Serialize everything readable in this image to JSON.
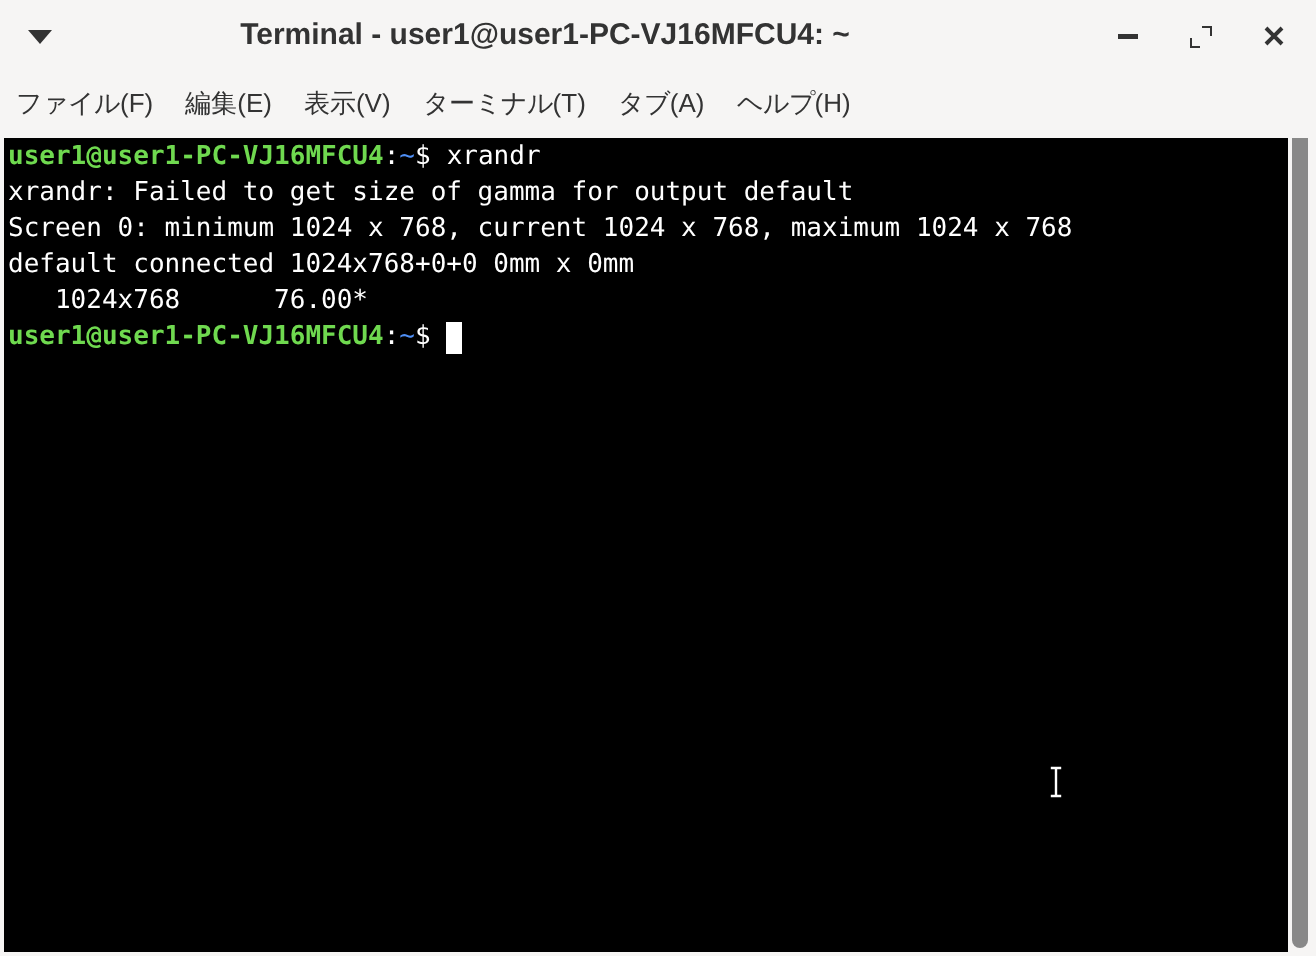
{
  "window": {
    "title": "Terminal - user1@user1-PC-VJ16MFCU4: ~"
  },
  "menu": [
    "ファイル(F)",
    "編集(E)",
    "表示(V)",
    "ターミナル(T)",
    "タブ(A)",
    "ヘルプ(H)"
  ],
  "terminal": {
    "lines": [
      {
        "kind": "prompt",
        "user_host": "user1@user1-PC-VJ16MFCU4",
        "separator": ":",
        "path": "~",
        "symbol": "$",
        "command": "xrandr"
      },
      {
        "kind": "output",
        "text": "xrandr: Failed to get size of gamma for output default"
      },
      {
        "kind": "output",
        "text": "Screen 0: minimum 1024 x 768, current 1024 x 768, maximum 1024 x 768"
      },
      {
        "kind": "output",
        "text": "default connected 1024x768+0+0 0mm x 0mm"
      },
      {
        "kind": "output",
        "text": "   1024x768      76.00*"
      },
      {
        "kind": "prompt",
        "user_host": "user1@user1-PC-VJ16MFCU4",
        "separator": ":",
        "path": "~",
        "symbol": "$",
        "cursor": true
      }
    ]
  }
}
